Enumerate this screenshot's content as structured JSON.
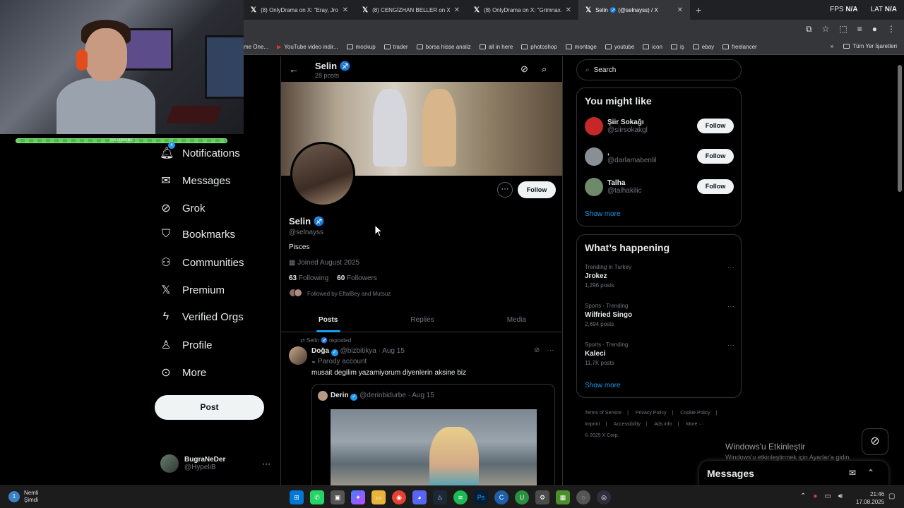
{
  "browser": {
    "tabs": [
      {
        "title": "(8) OnlyDrama on X: \"Eray, Jroi...",
        "active": false
      },
      {
        "title": "(8) CENGİZHAN BELLER on X: \"...",
        "active": false
      },
      {
        "title": "(8) OnlyDrama on X: \"Grimnax...",
        "active": false
      },
      {
        "title": "Selin ♐ (@selnayss) / X",
        "active": true
      }
    ],
    "new_tab": "+",
    "fps_label": "FPS",
    "fps_value": "N/A",
    "lat_label": "LAT",
    "lat_value": "N/A",
    "bookmarks": [
      "me Öne...",
      "YouTube video indir...",
      "mockup",
      "trader",
      "borsa hisse analiz",
      "all in here",
      "photoshop",
      "montage",
      "youtube",
      "icon",
      "iş",
      "ebay",
      "freelancer"
    ],
    "bookmarks_overflow": "»",
    "all_bookmarks": "Tüm Yer İşaretleri"
  },
  "webcam": {
    "follow_bar_label": "FOLLOWERS"
  },
  "nav": {
    "notifications_badge": "4",
    "items": [
      "Notifications",
      "Messages",
      "Grok",
      "Bookmarks",
      "Communities",
      "Premium",
      "Verified Orgs",
      "Profile",
      "More"
    ],
    "post_button": "Post",
    "account_name": "BugraNeDer",
    "account_handle": "@HypeliB",
    "account_more": "···"
  },
  "profile": {
    "header_name": "Selin ♐",
    "header_posts": "28 posts",
    "more_button": "···",
    "follow_button": "Follow",
    "name": "Selin ♐",
    "handle": "@selnayss",
    "bio": "Pisces",
    "joined": "Joined August 2025",
    "following_count": "63",
    "following_label": "Following",
    "followers_count": "60",
    "followers_label": "Followers",
    "followed_by": "Followed by EftalBey and Mutsuz",
    "tabs": [
      "Posts",
      "Replies",
      "Media"
    ]
  },
  "tweet": {
    "repost_line": "Selin ♐ reposted",
    "author_name": "Doğa",
    "author_handle": "@bizbitikya",
    "date": "· Aug 15",
    "parody": "Parody account",
    "text": "musait degilim yazamiyorum diyenlerin aksine biz",
    "quote_name": "Derin",
    "quote_handle": "@derinbidurbe",
    "quote_date": "· Aug 15"
  },
  "sidebar": {
    "search_placeholder": "Search",
    "might_like_title": "You might like",
    "suggestions": [
      {
        "name": "Şiir Sokağı",
        "handle": "@siirsokakgl",
        "button": "Follow",
        "avatar_color": "#c62828"
      },
      {
        "name": ",",
        "handle": "@darlamabenlil",
        "button": "Follow",
        "avatar_color": "#8a8f96"
      },
      {
        "name": "Talha",
        "handle": "@talhakilic",
        "button": "Follow",
        "avatar_color": "#6f8a6a"
      }
    ],
    "show_more_1": "Show more",
    "happening_title": "What’s happening",
    "trends": [
      {
        "context": "Trending in Turkey",
        "title": "Jrokez",
        "count": "1,296 posts"
      },
      {
        "context": "Sports · Trending",
        "title": "Wilfried Singo",
        "count": "2,694 posts"
      },
      {
        "context": "Sports · Trending",
        "title": "Kaleci",
        "count": "11.7K posts"
      }
    ],
    "show_more_2": "Show more",
    "footer": [
      "Terms of Service",
      "|",
      "Privacy Policy",
      "|",
      "Cookie Policy",
      "|",
      "Imprint",
      "|",
      "Accessibility",
      "|",
      "Ads info",
      "|",
      "More ···",
      "© 2025 X Corp."
    ]
  },
  "overlay": {
    "windows_activate": "Windows'u Etkinleştir",
    "windows_activate_sub": "Windows'u etkinleştirmek için Ayarlar'a gidin.",
    "messages_title": "Messages"
  },
  "taskbar": {
    "weather_line1": "Nemli",
    "weather_line2": "Şimdi",
    "weather_badge": "1",
    "time": "21:46",
    "date": "17.08.2025"
  },
  "colors": {
    "accent": "#1d9bf0",
    "background": "#000000",
    "border": "#2f3336",
    "muted_text": "#71767b"
  }
}
